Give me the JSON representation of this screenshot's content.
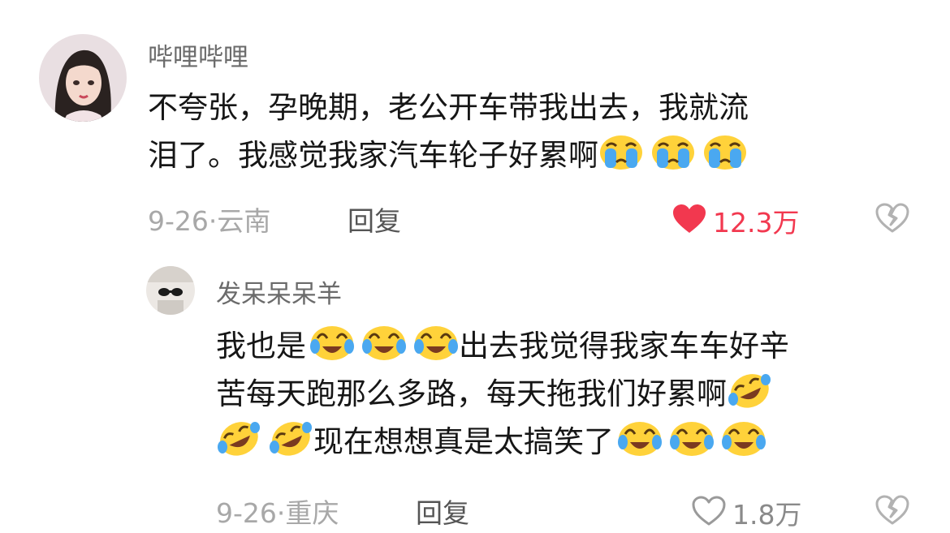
{
  "comment": {
    "username": "哔哩哔哩",
    "text_lines": [
      "不夸张，孕晚期，老公开车带我出去，我就流",
      "泪了。我感觉我家汽车轮子好累啊"
    ],
    "emojis_after_text": [
      "crying-face-emoji",
      "crying-face-emoji",
      "crying-face-emoji"
    ],
    "date": "9-26",
    "separator": "·",
    "location": "云南",
    "reply_label": "回复",
    "like_count": "12.3万",
    "liked": true,
    "like_color": "#f2384f"
  },
  "reply": {
    "username": "发呆呆呆羊",
    "line1_prefix": "我也是",
    "line1_suffix": "出去我觉得我家车车好辛",
    "line2": "苦每天跑那么多路，每天拖我们好累啊",
    "line3_suffix": "现在想想真是太搞笑了",
    "emoji_names": [
      "tears-of-joy-emoji",
      "rolling-laughing-emoji"
    ],
    "date": "9-26",
    "separator": "·",
    "location": "重庆",
    "reply_label": "回复",
    "like_count": "1.8万",
    "liked": false
  },
  "icons": {
    "heart": "heart-icon",
    "broken_heart": "broken-heart-icon"
  }
}
